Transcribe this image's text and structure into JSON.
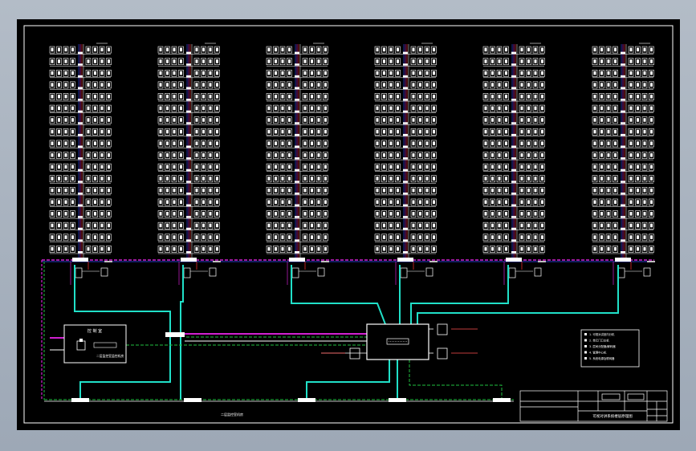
{
  "drawing": {
    "background": "#000000",
    "frame_color": "#ffffff",
    "bus_colors": {
      "magenta": "#d020d0",
      "cyan": "#20e0c8",
      "green": "#20c040",
      "white": "#ffffff",
      "blue": "#3050ff",
      "red": "#ff3030"
    }
  },
  "buildings": [
    {
      "id": "b1",
      "floors": 18
    },
    {
      "id": "b2",
      "floors": 18
    },
    {
      "id": "b3",
      "floors": 18
    },
    {
      "id": "b4",
      "floors": 18
    },
    {
      "id": "b5",
      "floors": 18
    },
    {
      "id": "b6",
      "floors": 18
    }
  ],
  "control_room": {
    "title": "控 制 室",
    "caption": "二层监控室监控机房"
  },
  "bottom_note": "二层监控室机房",
  "legend": {
    "rows": [
      "1. 可视对讲室内分机",
      "2. 单元门口主机",
      "3. 层间分配器/解码器",
      "4. 管理中心机",
      "5. 系统电源及联网器"
    ]
  },
  "title_block": {
    "drawing_title": "可视对讲系统楼层原理图"
  }
}
